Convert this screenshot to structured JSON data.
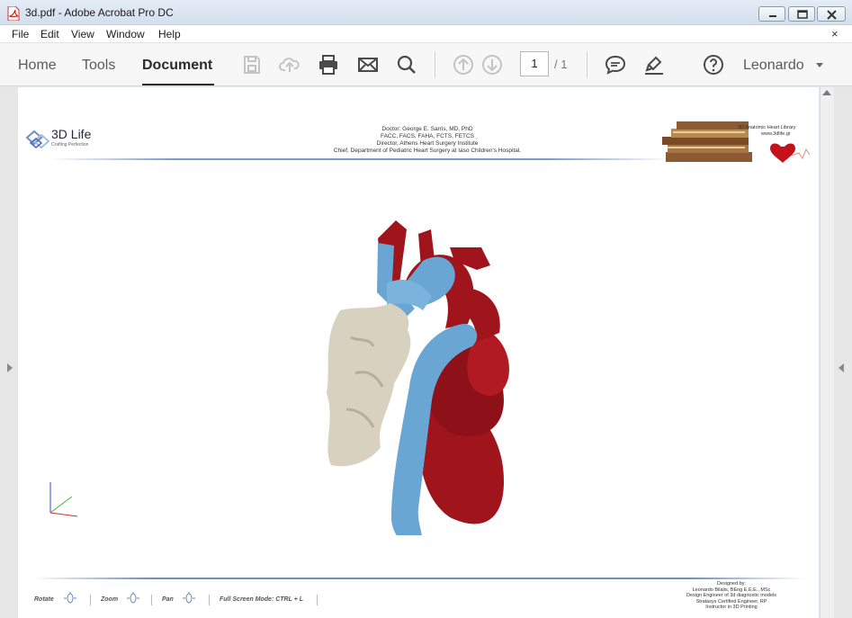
{
  "window": {
    "title": "3d.pdf - Adobe Acrobat Pro DC"
  },
  "menu": {
    "items": [
      "File",
      "Edit",
      "View",
      "Window",
      "Help"
    ],
    "close_glyph": "×"
  },
  "toolbar": {
    "tabs": [
      "Home",
      "Tools",
      "Document"
    ],
    "active_tab": "Document",
    "page_current": "1",
    "page_total": "/ 1",
    "user": "Leonardo",
    "icons": [
      "save-icon",
      "upload-icon",
      "print-icon",
      "mail-icon",
      "search-icon",
      "page-up-icon",
      "page-down-icon",
      "comment-icon",
      "highlight-icon",
      "help-icon"
    ]
  },
  "document": {
    "header": {
      "logo_text": "3D Life",
      "logo_sub": "Crafting Perfection",
      "doctor_lines": [
        "Doctor: George E. Sarris, MD, PhD",
        "FACC, FACS, FAHA, FCTS, FETCS",
        "Director, Athens Heart Surgery Institute",
        "Chief, Department of Pediatric Heart Surgery at Iaso Children's Hospital."
      ],
      "library_title": "3D Anatomic Heart Library",
      "library_url": "www.3dlife.gr"
    },
    "footer": {
      "controls": [
        {
          "label": "Rotate"
        },
        {
          "label": "Zoom"
        },
        {
          "label": "Pan"
        },
        {
          "label": "Full Screen Mode:  CTRL + L"
        }
      ],
      "credit_lines": [
        "Designed by:",
        "Leonardo Bilalis, BEng E.E.E., MSc",
        "Design Engineer of 3d diagnostic models",
        "Stratasys Certified Engineer, RP",
        "Instructor in 3D Printing"
      ]
    },
    "model": {
      "colors": {
        "heart": "#a0141c",
        "vessel": "#6aa6d4",
        "bone": "#d8d1c0"
      }
    }
  }
}
